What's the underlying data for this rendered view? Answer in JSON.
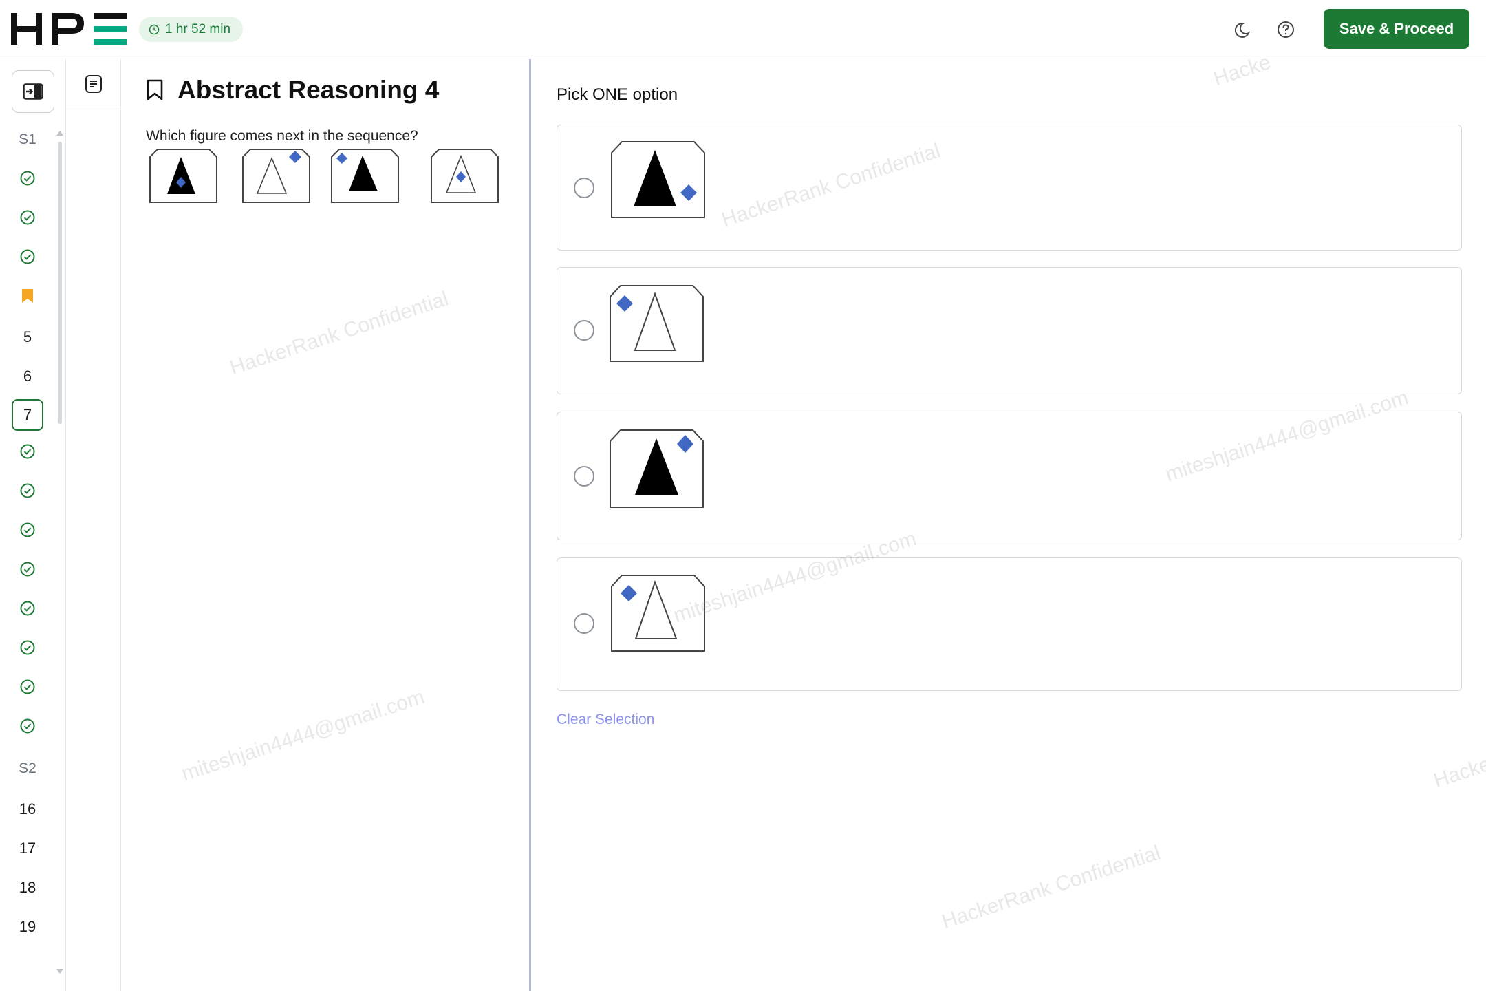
{
  "header": {
    "brand": "HPE",
    "timer": "1 hr 52 min",
    "theme_icon": "moon-icon",
    "help_icon": "help-circle-icon",
    "save_label": "Save & Proceed"
  },
  "nav": {
    "items": [
      {
        "kind": "section",
        "label": "S1"
      },
      {
        "kind": "done",
        "label": ""
      },
      {
        "kind": "done",
        "label": ""
      },
      {
        "kind": "done",
        "label": ""
      },
      {
        "kind": "bookmarked",
        "label": ""
      },
      {
        "kind": "number",
        "label": "5"
      },
      {
        "kind": "number",
        "label": "6"
      },
      {
        "kind": "current",
        "label": "7"
      },
      {
        "kind": "done",
        "label": ""
      },
      {
        "kind": "done",
        "label": ""
      },
      {
        "kind": "done",
        "label": ""
      },
      {
        "kind": "done",
        "label": ""
      },
      {
        "kind": "done",
        "label": ""
      },
      {
        "kind": "done",
        "label": ""
      },
      {
        "kind": "done",
        "label": ""
      },
      {
        "kind": "done",
        "label": ""
      },
      {
        "kind": "section",
        "label": "S2"
      },
      {
        "kind": "number",
        "label": "16"
      },
      {
        "kind": "number",
        "label": "17"
      },
      {
        "kind": "number",
        "label": "18"
      },
      {
        "kind": "number",
        "label": "19"
      }
    ]
  },
  "question": {
    "title": "Abstract Reasoning 4",
    "text": "Which figure comes next in the sequence?"
  },
  "options": {
    "prompt": "Pick ONE option",
    "clear_label": "Clear Selection"
  },
  "watermarks": {
    "company": "HackerRank Confidential",
    "email": "miteshjain4444@gmail.com",
    "partial": "Hacke"
  },
  "colors": {
    "accent": "#1c7a35",
    "diamond": "#4169c4",
    "logo_green": "#01a982"
  }
}
